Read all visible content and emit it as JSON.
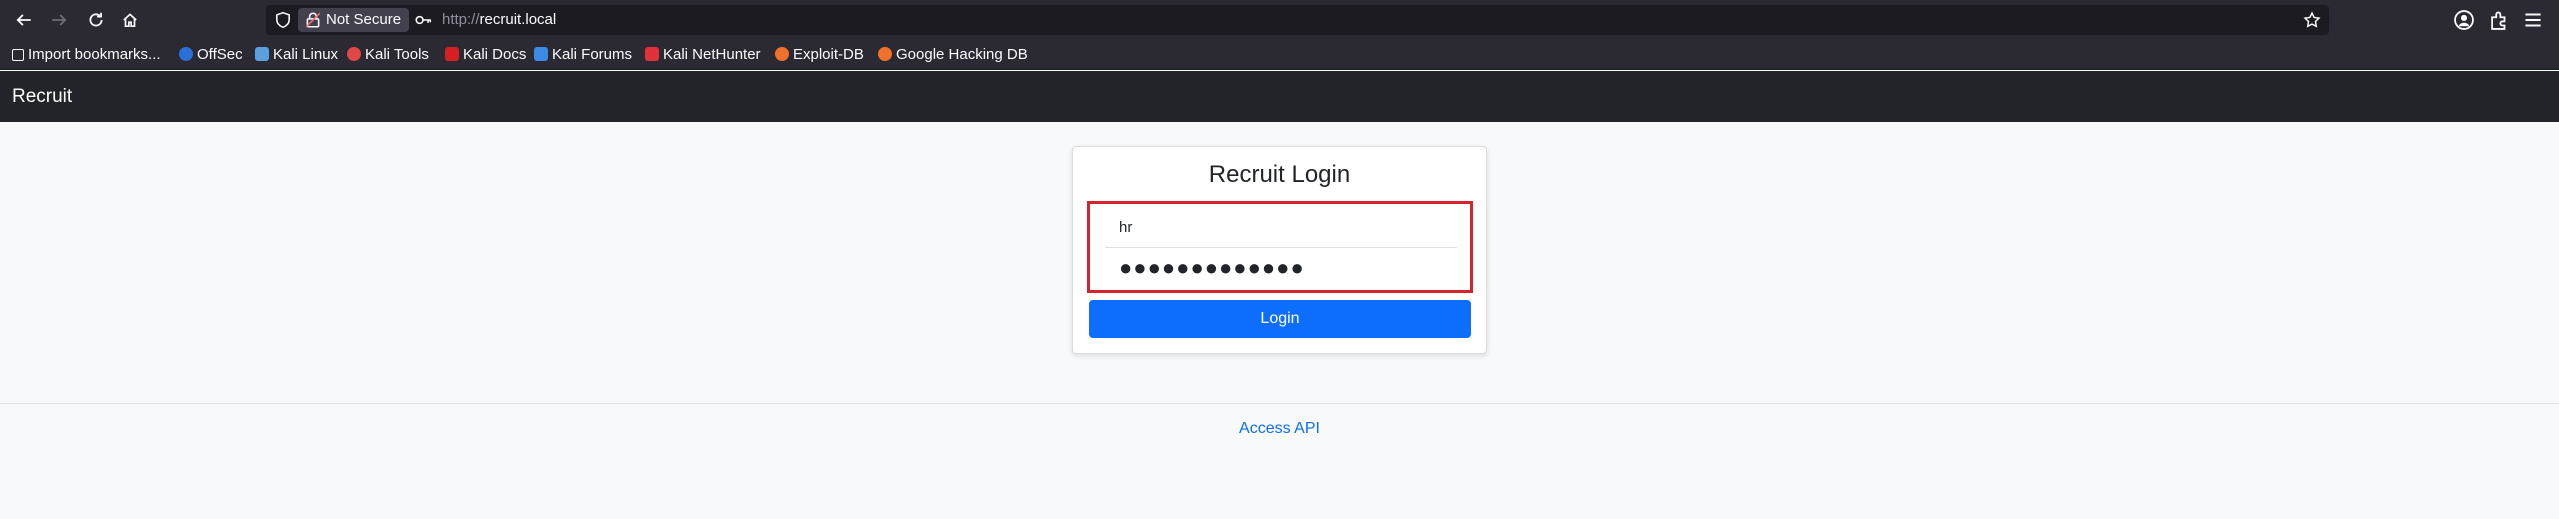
{
  "browser": {
    "security_label": "Not Secure",
    "url_scheme": "http://",
    "url_host": "recruit.local",
    "bookmarks": [
      {
        "label": "Import bookmarks...",
        "color": "#9e9e9e"
      },
      {
        "label": "OffSec",
        "color": "#2b6fd6"
      },
      {
        "label": "Kali Linux",
        "color": "#5aa0e0"
      },
      {
        "label": "Kali Tools",
        "color": "#e04848"
      },
      {
        "label": "Kali Docs",
        "color": "#d61f1f"
      },
      {
        "label": "Kali Forums",
        "color": "#3b8be6"
      },
      {
        "label": "Kali NetHunter",
        "color": "#e0303a"
      },
      {
        "label": "Exploit-DB",
        "color": "#f0712c"
      },
      {
        "label": "Google Hacking DB",
        "color": "#f0712c"
      }
    ]
  },
  "app": {
    "brand": "Recruit"
  },
  "login": {
    "title": "Recruit Login",
    "username_value": "hr",
    "password_value": "●●●●●●●●●●●●●",
    "button_label": "Login",
    "highlight_color": "#d6232d"
  },
  "footer": {
    "link_label": "Access API"
  },
  "colors": {
    "accent": "#0d6efd",
    "navbar": "#212529",
    "chrome": "#2b2a33"
  }
}
